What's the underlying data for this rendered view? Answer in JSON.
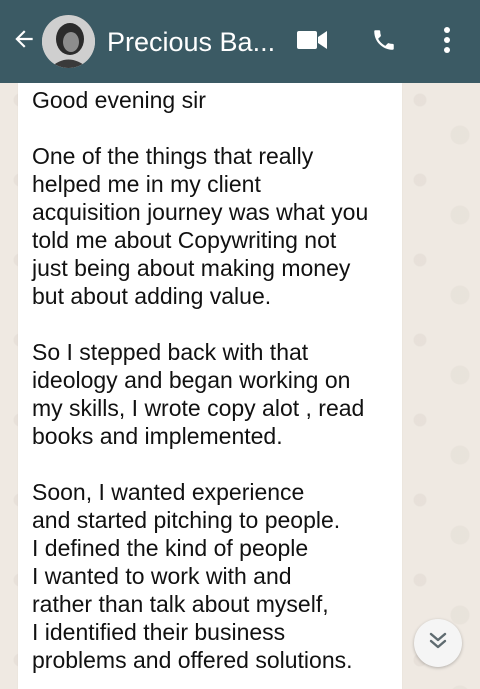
{
  "header": {
    "contact_name": "Precious Ba...",
    "background_color": "#3b5a64",
    "icons": {
      "back": "arrow-left-icon",
      "avatar": "contact-avatar",
      "video": "video-camera-icon",
      "call": "phone-icon",
      "menu": "more-vertical-icon"
    }
  },
  "message": {
    "paragraphs": [
      "Good evening sir",
      "One of the things that really\nhelped me in my client\nacquisition journey was what you\ntold me about Copywriting not\njust being about making money\nbut about adding value.",
      "So I stepped back with that\nideology and began working on\nmy skills, I wrote copy alot , read\nbooks and implemented.",
      "Soon, I wanted experience\nand started pitching to people.\nI defined the kind of people\nI wanted to work with and\nrather than talk about myself,\nI  identified their business\nproblems and offered solutions."
    ]
  },
  "scroll_button": {
    "icon": "double-chevron-down-icon"
  }
}
